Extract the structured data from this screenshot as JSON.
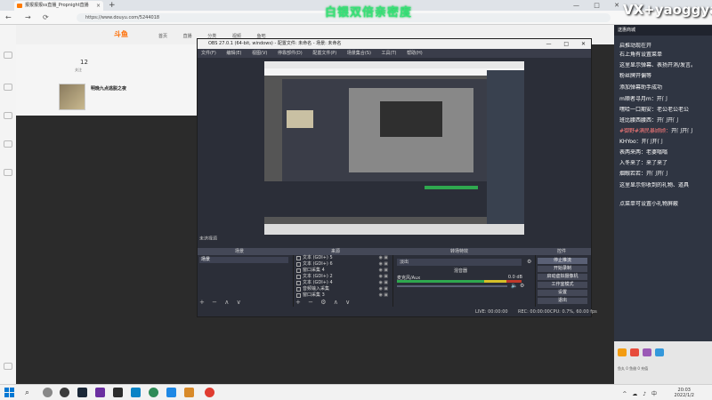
{
  "browser": {
    "tab_title": "报报报报ss直播_Propnight直播",
    "url": "https://www.douyu.com/5244018",
    "tab_close": "×",
    "new_tab": "+",
    "nav_back": "←",
    "nav_forward": "→",
    "nav_reload": "⟳",
    "window_controls": [
      "—",
      "□",
      "✕"
    ]
  },
  "site": {
    "logo": "斗鱼",
    "nav": [
      "首页",
      "直播",
      "分类",
      "视频",
      "鱼吧"
    ],
    "follower_count": "12",
    "follower_label": "关注",
    "room_title": "明晚九点逃脱之夜"
  },
  "overlays": {
    "green_banner": "白银双倍亲密度",
    "vx_banner": "VX+yaoggya"
  },
  "obs": {
    "title": "OBS 27.0.1 (64-bit, windows) - 配置文件: 未命名 - 场景: 未命名",
    "menu": [
      "文件(F)",
      "编辑(E)",
      "视图(V)",
      "停靠部件(D)",
      "配置文件(P)",
      "场景集合(S)",
      "工具(T)",
      "帮助(H)"
    ],
    "no_source_selected": "未选择源",
    "docks": {
      "scenes": "场景",
      "sources": "来源",
      "transitions": "转场特效",
      "mixer": "混音器",
      "controls": "控件"
    },
    "scene_items": [
      "场景"
    ],
    "source_items": [
      {
        "icon": "text-icon",
        "label": "文本 (GDI+) 5"
      },
      {
        "icon": "text-icon",
        "label": "文本 (GDI+) 6"
      },
      {
        "icon": "window-icon",
        "label": "窗口采集 4"
      },
      {
        "icon": "text-icon",
        "label": "文本 (GDI+) 2"
      },
      {
        "icon": "text-icon",
        "label": "文本 (GDI+) 4"
      },
      {
        "icon": "mic-icon",
        "label": "音频输入采集"
      },
      {
        "icon": "window-icon",
        "label": "窗口采集 3"
      }
    ],
    "transition_value": "淡出",
    "mixer_track": "麦克风/Aux",
    "mixer_db": "0.0 dB",
    "controls": [
      "停止推流",
      "开始录制",
      "启动虚拟摄像机",
      "工作室模式",
      "设置",
      "退出"
    ],
    "status": {
      "live": "LIVE: 00:00:00",
      "rec": "REC: 00:00:00",
      "cpu": "CPU: 0.7%, 60.00 fps"
    }
  },
  "chat": {
    "header": "送惠商城",
    "messages": [
      {
        "name": "",
        "text": "启推动现在开"
      },
      {
        "name": "",
        "text": "右上角有设置菜单"
      },
      {
        "name": "",
        "text": "这里显示弹幕、表扬开消/发言。"
      },
      {
        "name": "",
        "text": "粉丝牌开偏等"
      },
      {
        "name": "",
        "text": "添加弹幕助手成功"
      },
      {
        "name": "m顺者寻月m：",
        "text": "开门"
      },
      {
        "name": "嘿哈一口期安：",
        "text": "老公老公老公"
      },
      {
        "name": "班比腰西腰西：",
        "text": "开门开门"
      },
      {
        "name": "#御野#满民暴顾顾：",
        "text": "开门开门",
        "highlight": true
      },
      {
        "name": "KHYoo：",
        "text": "开门开门"
      },
      {
        "name": "表两来两：",
        "text": "老婆嗡嗡"
      },
      {
        "name": "入冬来了：",
        "text": "来了来了"
      },
      {
        "name": "烟眼若若：",
        "text": "开门开门"
      },
      {
        "name": "",
        "text": "这里显示你收到的礼物、道具"
      },
      {
        "name": "",
        "text": ""
      },
      {
        "name": "",
        "text": "点菜单可设置小礼物屏蔽"
      }
    ],
    "footer_row": "鱼丸 0 鱼翅 0  充值"
  },
  "taskbar": {
    "time": "20:03",
    "date": "2022/1/2",
    "search_icon": "⌕",
    "tray_glyphs": [
      "^",
      "☁",
      "♪",
      "中"
    ]
  }
}
